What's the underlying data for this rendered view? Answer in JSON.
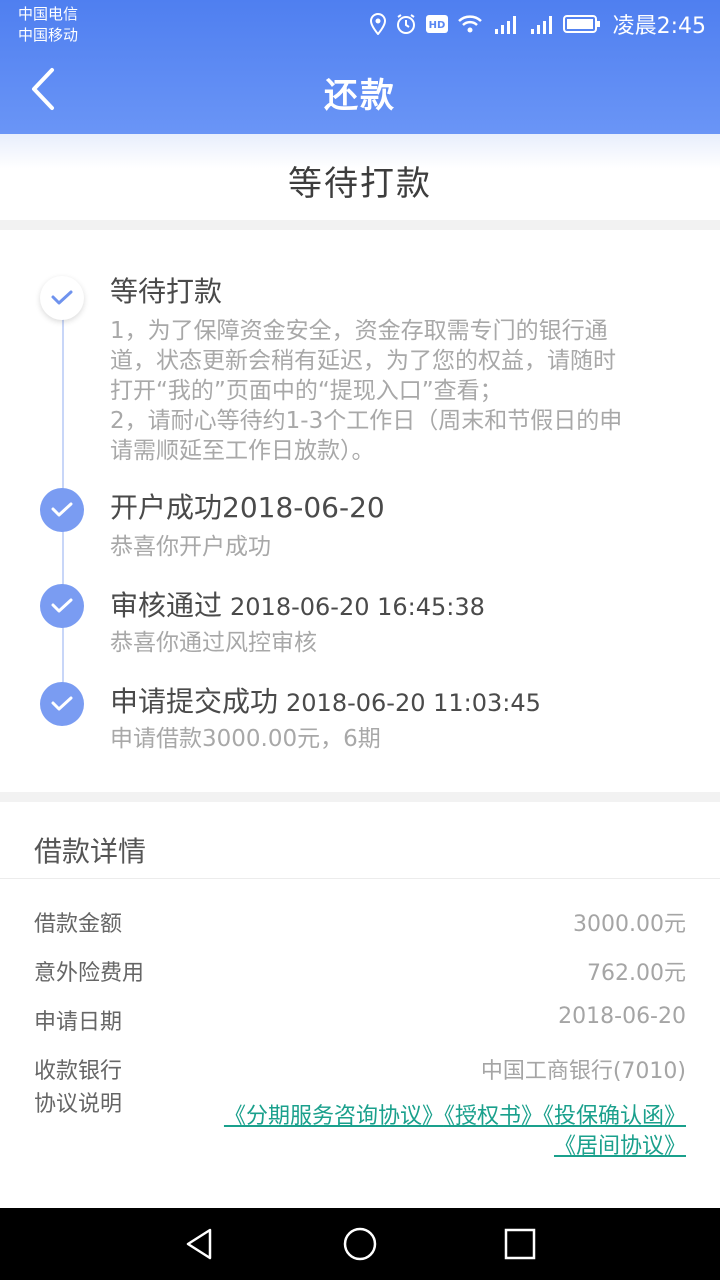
{
  "status_bar": {
    "carrier1": "中国电信",
    "carrier2": "中国移动",
    "time": "凌晨2:45"
  },
  "nav": {
    "title": "还款"
  },
  "sub_header": {
    "title": "等待打款"
  },
  "timeline": [
    {
      "title": "等待打款",
      "time": "",
      "desc_lines": [
        "1，为了保障资金安全，资金存取需专门的银行通",
        "道，状态更新会稍有延迟，为了您的权益，请随时",
        "打开“我的”页面中的“提现入口”查看；",
        "2，请耐心等待约1-3个工作日（周末和节假日的申",
        "请需顺延至工作日放款）。"
      ],
      "state": "pending"
    },
    {
      "title": "开户成功2018-06-20",
      "time": "",
      "desc": "恭喜你开户成功",
      "state": "done"
    },
    {
      "title": "审核通过",
      "time": "2018-06-20 16:45:38",
      "desc": "恭喜你通过风控审核",
      "state": "done"
    },
    {
      "title": "申请提交成功",
      "time": "2018-06-20 11:03:45",
      "desc": "申请借款3000.00元，6期",
      "state": "done"
    }
  ],
  "details": {
    "title": "借款详情",
    "rows": [
      {
        "label": "借款金额",
        "value": "3000.00元"
      },
      {
        "label": "意外险费用",
        "value": "762.00元"
      },
      {
        "label": "申请日期",
        "value": "2018-06-20"
      },
      {
        "label": "收款银行",
        "value": "中国工商银行(7010)"
      }
    ],
    "agreement_label": "协议说明",
    "agreements": [
      "《分期服务咨询协议》",
      "《授权书》",
      "《投保确认函》",
      "《居间协议》"
    ]
  },
  "colors": {
    "header_blue": "#5a87f3",
    "timeline_dot": "#7a9cf2",
    "link_green": "#1aa08c"
  }
}
